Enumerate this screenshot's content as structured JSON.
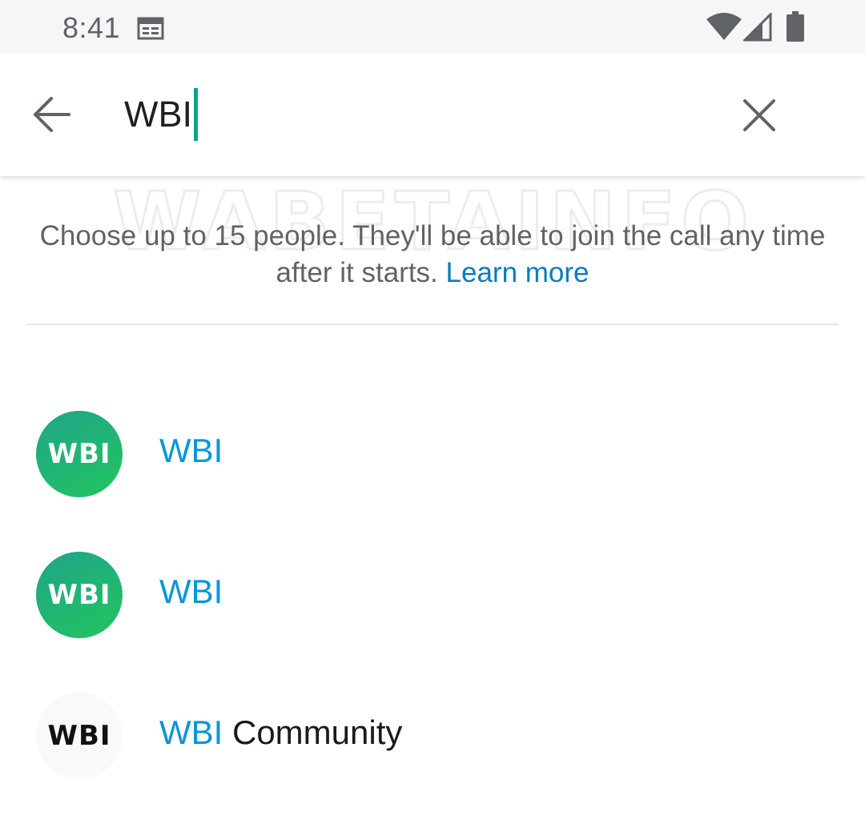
{
  "status_bar": {
    "time": "8:41",
    "icons": [
      "calendar-icon",
      "wifi-icon",
      "signal-icon",
      "battery-icon"
    ]
  },
  "search": {
    "value": "WBI",
    "back_icon": "arrow-left-icon",
    "clear_icon": "close-icon"
  },
  "watermark": {
    "text": "WABETAINFO"
  },
  "info": {
    "text": "Choose up to 15 people. They'll be able to join the call any time after it starts.",
    "learn_more": "Learn more"
  },
  "contacts": [
    {
      "avatar_text": "WBI",
      "name_highlight": "WBI",
      "name_rest": ""
    },
    {
      "avatar_text": "WBI",
      "name_highlight": "WBI",
      "name_rest": ""
    },
    {
      "avatar_text": "WBI",
      "name_highlight": "WBI",
      "name_rest": " Community"
    }
  ],
  "colors": {
    "accent_green": "#00a884",
    "highlight_blue": "#0a95d8",
    "link_blue": "#0a7bbf",
    "avatar_green": "#22c45e"
  }
}
